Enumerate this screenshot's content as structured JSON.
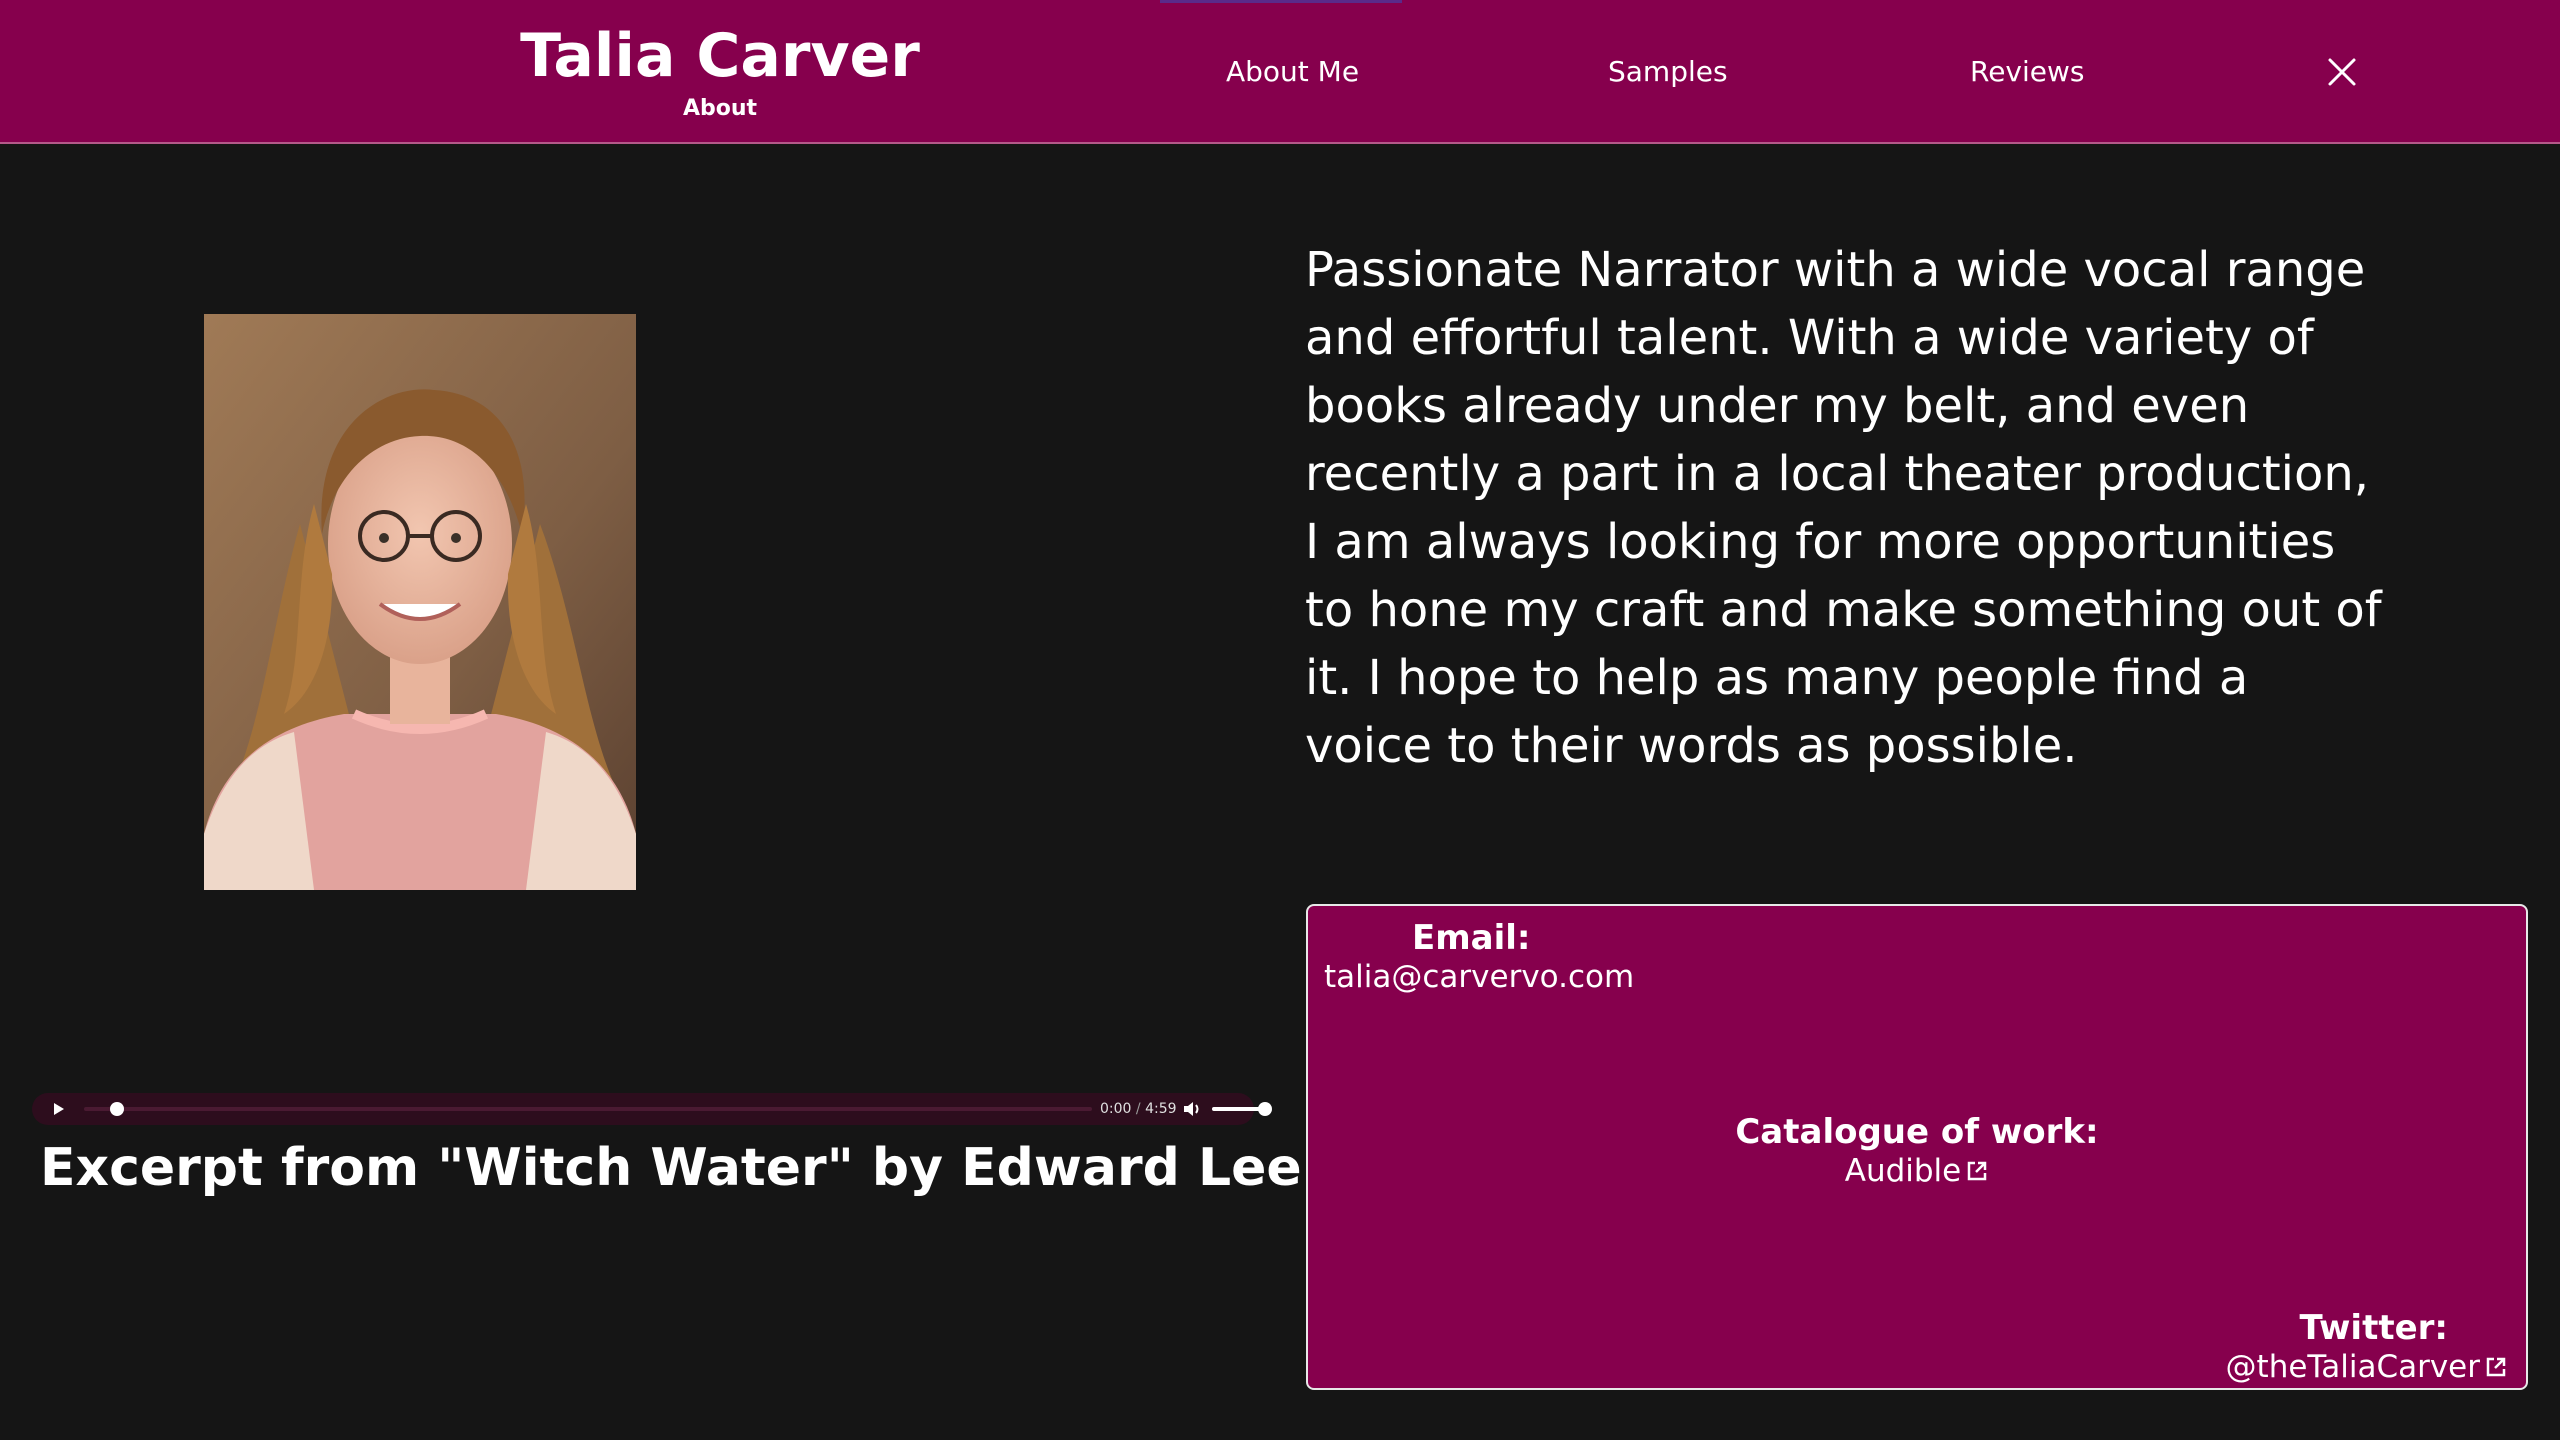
{
  "header": {
    "title": "Talia Carver",
    "subtitle": "About",
    "nav": {
      "about": "About Me",
      "samples": "Samples",
      "reviews": "Reviews"
    },
    "close_icon": "close-icon"
  },
  "colors": {
    "brand": "#86004d",
    "background": "#151515",
    "text": "#ffffff"
  },
  "profile": {
    "photo_alt": "Portrait photo of Talia Carver"
  },
  "bio": {
    "text": "Passionate Narrator with a wide vocal range and effortful talent. With a wide variety of books already under my belt, and even recently a part in a local theater production, I am always looking for more opportunities to hone my craft and make something out of it. I hope to help as many people find a voice to their words as possible."
  },
  "audio": {
    "current": "0:00",
    "separator": "/",
    "duration": "4:59",
    "progress": 0,
    "volume": 1.0,
    "play_icon": "play-icon",
    "volume_icon": "volume-icon"
  },
  "sample": {
    "caption": "Excerpt from \"Witch Water\" by Edward Lee"
  },
  "contact": {
    "email_label": "Email:",
    "email_value": "talia@carvervo.com",
    "catalogue_label": "Catalogue of work:",
    "catalogue_value": "Audible",
    "twitter_label": "Twitter:",
    "twitter_value": "@theTaliaCarver",
    "external_icon": "external-link-icon"
  }
}
